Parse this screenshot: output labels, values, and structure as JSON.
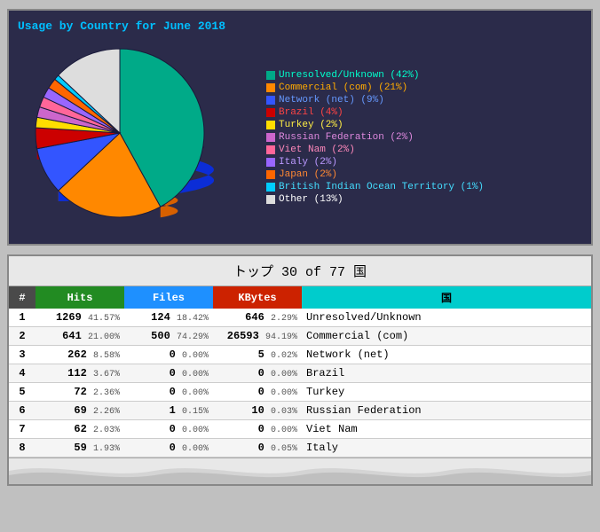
{
  "chart": {
    "title": "Usage by Country for June 2018",
    "legend": [
      {
        "label": "Unresolved/Unknown (42%)",
        "color": "#00cc99"
      },
      {
        "label": "Commercial (com) (21%)",
        "color": "#ff9900"
      },
      {
        "label": "Network (net) (9%)",
        "color": "#3366ff"
      },
      {
        "label": "Brazil (4%)",
        "color": "#cc0000"
      },
      {
        "label": "Turkey (2%)",
        "color": "#ffcc00"
      },
      {
        "label": "Russian Federation (2%)",
        "color": "#cc66cc"
      },
      {
        "label": "Viet Nam (2%)",
        "color": "#ff6699"
      },
      {
        "label": "Italy (2%)",
        "color": "#9966ff"
      },
      {
        "label": "Japan (2%)",
        "color": "#ff6600"
      },
      {
        "label": "British Indian Ocean Territory (1%)",
        "color": "#00ccff"
      },
      {
        "label": "Other (13%)",
        "color": "#ffffff"
      }
    ],
    "pie_segments": [
      {
        "percent": 42,
        "color": "#00aa88",
        "label": "Unresolved/Unknown"
      },
      {
        "percent": 21,
        "color": "#ff8800",
        "label": "Commercial"
      },
      {
        "percent": 9,
        "color": "#3355ff",
        "label": "Network"
      },
      {
        "percent": 4,
        "color": "#cc0000",
        "label": "Brazil"
      },
      {
        "percent": 2,
        "color": "#ffdd00",
        "label": "Turkey"
      },
      {
        "percent": 2,
        "color": "#cc66cc",
        "label": "Russia"
      },
      {
        "percent": 2,
        "color": "#ff6699",
        "label": "VietNam"
      },
      {
        "percent": 2,
        "color": "#9966ff",
        "label": "Italy"
      },
      {
        "percent": 2,
        "color": "#ff6600",
        "label": "Japan"
      },
      {
        "percent": 1,
        "color": "#00ccff",
        "label": "BIOT"
      },
      {
        "percent": 13,
        "color": "#dddddd",
        "label": "Other"
      }
    ]
  },
  "table": {
    "title": "トップ 30 of 77 国",
    "headers": [
      "#",
      "Hits",
      "Files",
      "KBytes",
      "国"
    ],
    "rows": [
      {
        "rank": 1,
        "hits": 1269,
        "hits_pct": "41.57%",
        "files": 124,
        "files_pct": "18.42%",
        "kbytes": 646,
        "kbytes_pct": "2.29%",
        "country": "Unresolved/Unknown"
      },
      {
        "rank": 2,
        "hits": 641,
        "hits_pct": "21.00%",
        "files": 500,
        "files_pct": "74.29%",
        "kbytes": 26593,
        "kbytes_pct": "94.19%",
        "country": "Commercial (com)"
      },
      {
        "rank": 3,
        "hits": 262,
        "hits_pct": "8.58%",
        "files": 0,
        "files_pct": "0.00%",
        "kbytes": 5,
        "kbytes_pct": "0.02%",
        "country": "Network (net)"
      },
      {
        "rank": 4,
        "hits": 112,
        "hits_pct": "3.67%",
        "files": 0,
        "files_pct": "0.00%",
        "kbytes": 0,
        "kbytes_pct": "0.00%",
        "country": "Brazil"
      },
      {
        "rank": 5,
        "hits": 72,
        "hits_pct": "2.36%",
        "files": 0,
        "files_pct": "0.00%",
        "kbytes": 0,
        "kbytes_pct": "0.00%",
        "country": "Turkey"
      },
      {
        "rank": 6,
        "hits": 69,
        "hits_pct": "2.26%",
        "files": 1,
        "files_pct": "0.15%",
        "kbytes": 10,
        "kbytes_pct": "0.03%",
        "country": "Russian Federation"
      },
      {
        "rank": 7,
        "hits": 62,
        "hits_pct": "2.03%",
        "files": 0,
        "files_pct": "0.00%",
        "kbytes": 0,
        "kbytes_pct": "0.00%",
        "country": "Viet Nam"
      },
      {
        "rank": 8,
        "hits": 59,
        "hits_pct": "1.93%",
        "files": 0,
        "files_pct": "0.00%",
        "kbytes": 0,
        "kbytes_pct": "0.05%",
        "country": "Italy"
      }
    ]
  }
}
